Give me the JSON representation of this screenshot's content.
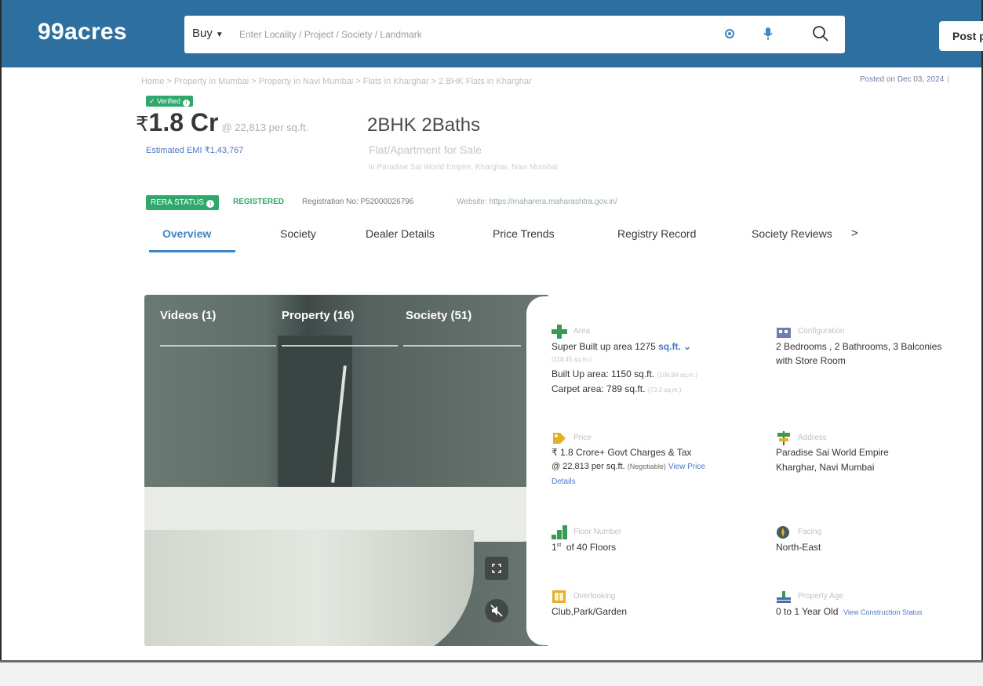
{
  "header": {
    "logo": "99acres",
    "search": {
      "mode_label": "Buy",
      "placeholder": "Enter Locality / Project / Society / Landmark"
    },
    "post_button_label": "Post p"
  },
  "breadcrumb": "Home  >  Property in Mumbai  >  Property in Navi Mumbai  >  Flats in Kharghar  >  2 BHK Flats in Kharghar",
  "posted_on": "Posted on Dec 03, 2024",
  "verified_label": "Verified",
  "price": {
    "value": "1.8 Cr",
    "per_sqft": "@ 22,813 per sq.ft.",
    "emi": "Estimated EMI ₹1,43,767"
  },
  "listing": {
    "title": "2BHK 2Baths",
    "subtitle": "Flat/Apartment for Sale",
    "location_line": "in Paradise Sai World Empire, Kharghar, Navi Mumbai"
  },
  "rera": {
    "badge": "RERA STATUS",
    "status": "REGISTERED",
    "registration": "Registration No: P52000026796",
    "website": "Website: https://maharera.maharashtra.gov.in/"
  },
  "tabs": [
    {
      "label": "Overview"
    },
    {
      "label": "Society"
    },
    {
      "label": "Dealer Details"
    },
    {
      "label": "Price Trends"
    },
    {
      "label": "Registry Record"
    },
    {
      "label": "Society Reviews"
    }
  ],
  "tabs_more": ">",
  "gallery": {
    "tabs": [
      {
        "label": "Videos (1)"
      },
      {
        "label": "Property (16)"
      },
      {
        "label": "Society (51)"
      }
    ]
  },
  "details": {
    "area": {
      "label": "Area",
      "super_built_up": "Super Built up area 1275",
      "unit": "sq.ft.",
      "super_sqm": "(118.45 sq.m.)",
      "built_up": "Built Up area: 1150 sq.ft.",
      "built_up_sqm": "(106.84 sq.m.)",
      "carpet": "Carpet area: 789 sq.ft.",
      "carpet_sqm": "(73.3 sq.m.)"
    },
    "configuration": {
      "label": "Configuration",
      "line1": "2 Bedrooms , 2 Bathrooms, 3 Balconies",
      "line2": "with Store Room"
    },
    "price": {
      "label": "Price",
      "line1": "₹ 1.8 Crore+ Govt Charges & Tax",
      "line2": "@ 22,813 per sq.ft.",
      "negotiable": "(Negotiable)",
      "view_link": "View Price",
      "view_link2": "Details"
    },
    "address": {
      "label": "Address",
      "line1": "Paradise Sai World Empire",
      "line2": "Kharghar, Navi Mumbai"
    },
    "floor": {
      "label": "Floor Number",
      "value_sup": "st",
      "value_num": "1",
      "value_rest": "of 40 Floors"
    },
    "facing": {
      "label": "Facing",
      "value": "North-East"
    },
    "overlooking": {
      "label": "Overlooking",
      "value": "Club,Park/Garden"
    },
    "age": {
      "label": "Property Age",
      "value": "0 to 1 Year Old",
      "link": "View Construction Status"
    }
  },
  "colors": {
    "brand_blue": "#2d6f9e",
    "accent_link": "#3d86c6",
    "verified_green": "#2fa86b"
  }
}
